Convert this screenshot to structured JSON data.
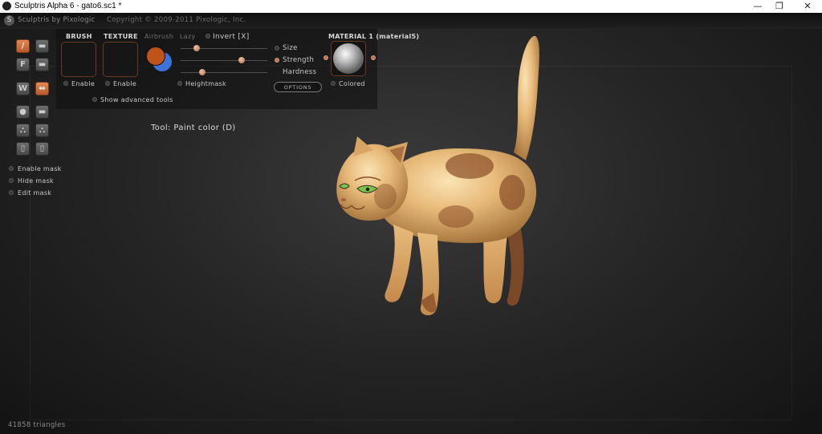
{
  "window": {
    "title": "Sculptris Alpha 6 - gato6.sc1 *",
    "controls": {
      "minimize": "—",
      "restore": "❐",
      "close": "✕"
    }
  },
  "header": {
    "brand": "Sculptris by Pixologic",
    "copyright": "Copyright © 2009-2011 Pixologic, Inc."
  },
  "toolbar": {
    "tools": [
      {
        "name": "paint-brush",
        "glyph": "/",
        "active": true
      },
      {
        "name": "sculpt-layer",
        "glyph": "▬",
        "active": false
      },
      {
        "name": "flatten",
        "glyph": "F",
        "active": false
      },
      {
        "name": "smooth",
        "glyph": "▬",
        "active": false
      },
      {
        "name": "wave",
        "glyph": "W",
        "active": false
      },
      {
        "name": "symmetry",
        "glyph": "⇔",
        "active": true
      },
      {
        "name": "sphere",
        "glyph": "●",
        "active": false
      },
      {
        "name": "plane",
        "glyph": "▬",
        "active": false
      },
      {
        "name": "grab",
        "glyph": "⛬",
        "active": false
      },
      {
        "name": "pinch",
        "glyph": "⛬",
        "active": false
      },
      {
        "name": "scale",
        "glyph": "▯",
        "active": false
      },
      {
        "name": "rotate",
        "glyph": "▯",
        "active": false
      }
    ]
  },
  "mask": {
    "enable": "Enable mask",
    "hide": "Hide mask",
    "edit": "Edit mask"
  },
  "panel": {
    "brush_label": "BRUSH",
    "texture_label": "TEXTURE",
    "airbrush_label": "Airbrush",
    "lazy_label": "Lazy",
    "invert_label": "Invert [X]",
    "brush_enable": "Enable",
    "texture_enable": "Enable",
    "heightmask": "Heightmask",
    "advanced": "Show advanced tools",
    "size_label": "Size",
    "strength_label": "Strength",
    "hardness_label": "Hardness",
    "options_button": "OPTIONS",
    "material_label": "MATERIAL 1 (material5)",
    "colored_label": "Colored",
    "sliders": {
      "size": 0.2,
      "strength": 0.7,
      "hardness": 0.25
    },
    "colors": {
      "primary": "#c0531a",
      "secondary": "#3d72d8"
    }
  },
  "status": {
    "tool": "Tool: Paint color (D)",
    "triangles": "41858 triangles"
  },
  "accent": "#d27a48"
}
